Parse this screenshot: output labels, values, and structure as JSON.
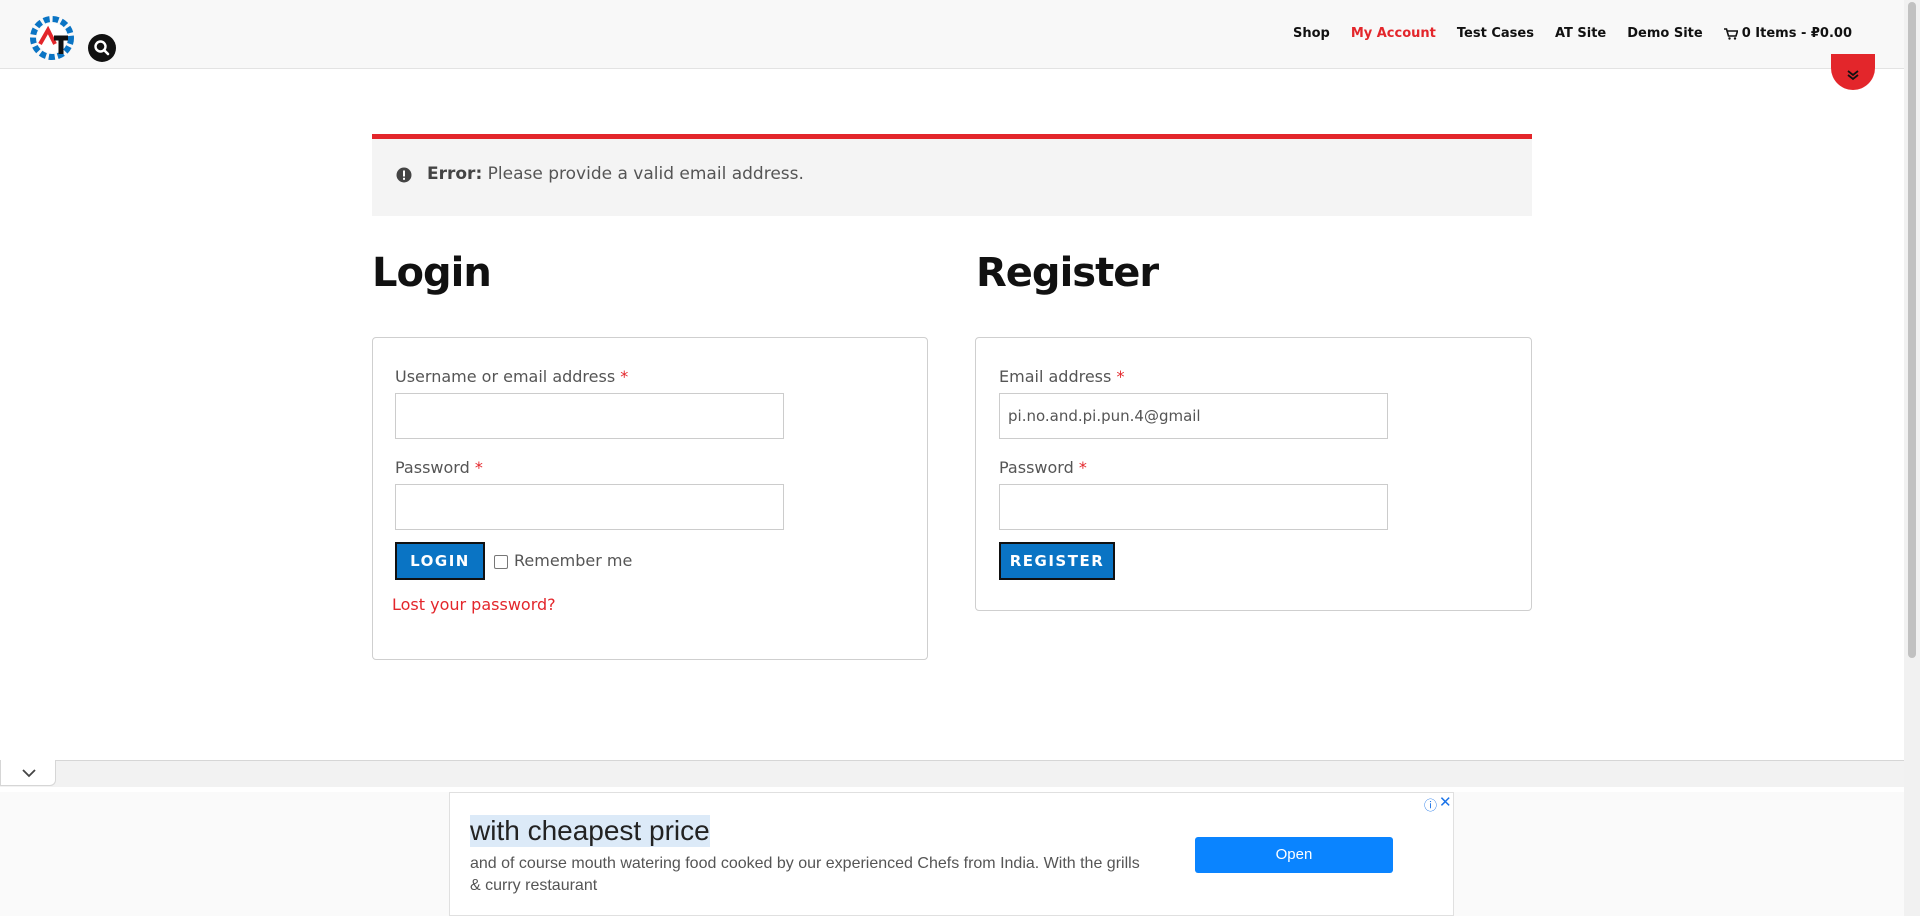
{
  "header": {
    "nav": [
      {
        "label": "Shop"
      },
      {
        "label": "My Account"
      },
      {
        "label": "Test Cases"
      },
      {
        "label": "AT Site"
      },
      {
        "label": "Demo Site"
      }
    ],
    "cart_label": "0 Items - ₽0.00"
  },
  "notice": {
    "prefix": "Error:",
    "message": "Please provide a valid email address."
  },
  "login": {
    "title": "Login",
    "username_label": "Username or email address",
    "username_value": "",
    "password_label": "Password",
    "password_value": "",
    "required_mark": "*",
    "button_label": "LOGIN",
    "remember_label": "Remember me",
    "lost_password_label": "Lost your password?"
  },
  "register": {
    "title": "Register",
    "email_label": "Email address",
    "email_value": "pi.no.and.pi.pun.4@gmail",
    "password_label": "Password",
    "password_value": "",
    "required_mark": "*",
    "button_label": "REGISTER"
  },
  "ad": {
    "title": "with cheapest price",
    "description": "and of course mouth watering food cooked by our experienced Chefs from India. With the grills & curry restaurant",
    "button_label": "Open",
    "info_glyph": "ⓘ",
    "close_glyph": "✕"
  },
  "colors": {
    "accent_red": "#e3262b",
    "button_blue": "#0a74c4",
    "ad_blue": "#0a84ff"
  }
}
